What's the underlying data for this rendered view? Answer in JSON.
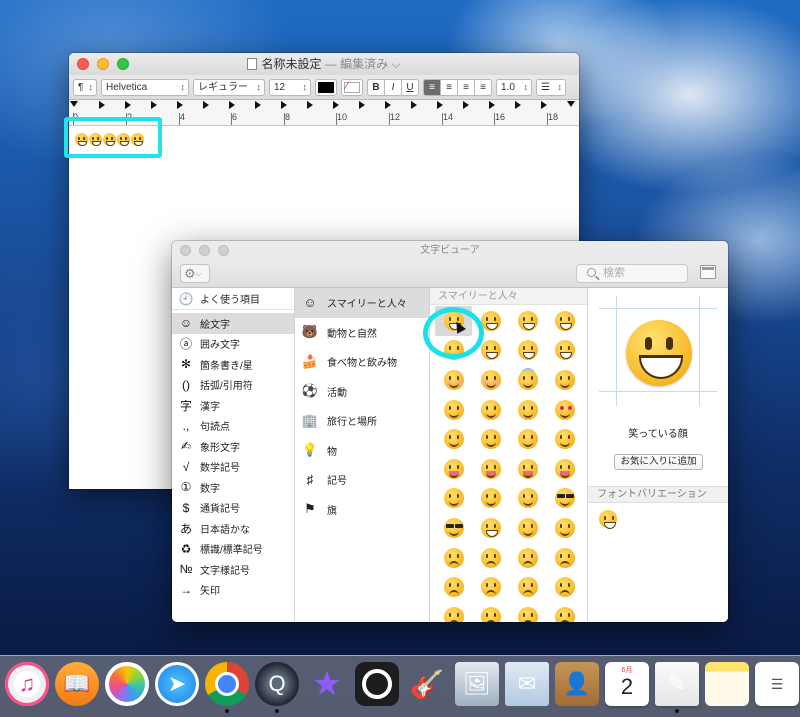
{
  "textedit": {
    "title": "名称未設定",
    "title_status": "— 編集済み ⌵",
    "toolbar": {
      "paragraph_style": "¶",
      "font_family": "Helvetica",
      "font_style": "レギュラー",
      "font_size": "12",
      "bold": "B",
      "italic": "I",
      "underline": "U",
      "line_spacing": "1.0",
      "list": "☰"
    },
    "ruler_numbers": [
      "0",
      "2",
      "4",
      "6",
      "8",
      "10",
      "12",
      "14",
      "16",
      "18"
    ],
    "document_text": "😀😀😀😀😀"
  },
  "character_viewer": {
    "title": "文字ビューア",
    "search_placeholder": "検索",
    "sidebar": [
      {
        "glyph": "🕘",
        "label": "よく使う項目"
      },
      {
        "glyph": "☺",
        "label": "絵文字",
        "selected": true
      },
      {
        "glyph": "ⓐ",
        "label": "囲み文字"
      },
      {
        "glyph": "✻",
        "label": "箇条書き/星"
      },
      {
        "glyph": "()",
        "label": "括弧/引用符"
      },
      {
        "glyph": "字",
        "label": "漢字"
      },
      {
        "glyph": ".,",
        "label": "句読点"
      },
      {
        "glyph": "✍",
        "label": "象形文字"
      },
      {
        "glyph": "√",
        "label": "数学記号"
      },
      {
        "glyph": "①",
        "label": "数字"
      },
      {
        "glyph": "$",
        "label": "通貨記号"
      },
      {
        "glyph": "あ",
        "label": "日本語かな"
      },
      {
        "glyph": "♻",
        "label": "標識/標準記号"
      },
      {
        "glyph": "№",
        "label": "文字様記号"
      },
      {
        "glyph": "→",
        "label": "矢印"
      }
    ],
    "categories": [
      {
        "glyph": "☺",
        "label": "スマイリーと人々",
        "selected": true
      },
      {
        "glyph": "🐻",
        "label": "動物と自然"
      },
      {
        "glyph": "🍰",
        "label": "食べ物と飲み物"
      },
      {
        "glyph": "⚽",
        "label": "活動"
      },
      {
        "glyph": "🏢",
        "label": "旅行と場所"
      },
      {
        "glyph": "💡",
        "label": "物"
      },
      {
        "glyph": "♯",
        "label": "記号"
      },
      {
        "glyph": "⚑",
        "label": "旗"
      }
    ],
    "grid_header": "スマイリーと人々",
    "grid_variants": [
      "grin",
      "grin",
      "grin",
      "grin",
      "smile",
      "grin",
      "grin",
      "grin",
      "blush",
      "blush",
      "halo",
      "smile",
      "smile",
      "smile",
      "smile",
      "hearts",
      "smile",
      "smile",
      "smile",
      "smile",
      "tongue",
      "tongue",
      "tongue",
      "tongue",
      "smile",
      "smile",
      "smile",
      "cool",
      "cool",
      "grin",
      "smile",
      "smile",
      "sad",
      "sad",
      "sad",
      "sad",
      "sad",
      "sad",
      "sad",
      "sad",
      "sad",
      "sad",
      "sad",
      "sad"
    ],
    "detail": {
      "name": "笑っている顔",
      "favorite_button": "お気に入りに追加",
      "font_variation_header": "フォントバリエーション"
    }
  },
  "dock": {
    "apps": [
      {
        "name": "itunes",
        "glyph": "♫",
        "running": false
      },
      {
        "name": "ibooks",
        "glyph": "📖",
        "running": false
      },
      {
        "name": "photos",
        "glyph": "",
        "running": false
      },
      {
        "name": "safari",
        "glyph": "➤",
        "running": false
      },
      {
        "name": "chrome",
        "glyph": "",
        "running": true
      },
      {
        "name": "quicktime",
        "glyph": "Q",
        "running": true
      },
      {
        "name": "imovie",
        "glyph": "★",
        "running": false
      },
      {
        "name": "quicktime-player",
        "glyph": "",
        "running": false
      },
      {
        "name": "garageband",
        "glyph": "🎸",
        "running": false
      },
      {
        "name": "preview",
        "glyph": "🖼",
        "running": false
      },
      {
        "name": "mail",
        "glyph": "✉",
        "running": false
      },
      {
        "name": "contacts",
        "glyph": "👤",
        "running": false
      },
      {
        "name": "calendar",
        "glyph": "",
        "running": false
      },
      {
        "name": "textedit",
        "glyph": "✎",
        "running": true
      },
      {
        "name": "notes",
        "glyph": "",
        "running": false
      },
      {
        "name": "reminders",
        "glyph": "☰",
        "running": false
      }
    ],
    "calendar_month": "6月",
    "calendar_day": "2"
  },
  "colors": {
    "highlight": "#22e3ea",
    "close": "#fc5b57",
    "minimize": "#fdbc2e",
    "maximize": "#33c748"
  }
}
